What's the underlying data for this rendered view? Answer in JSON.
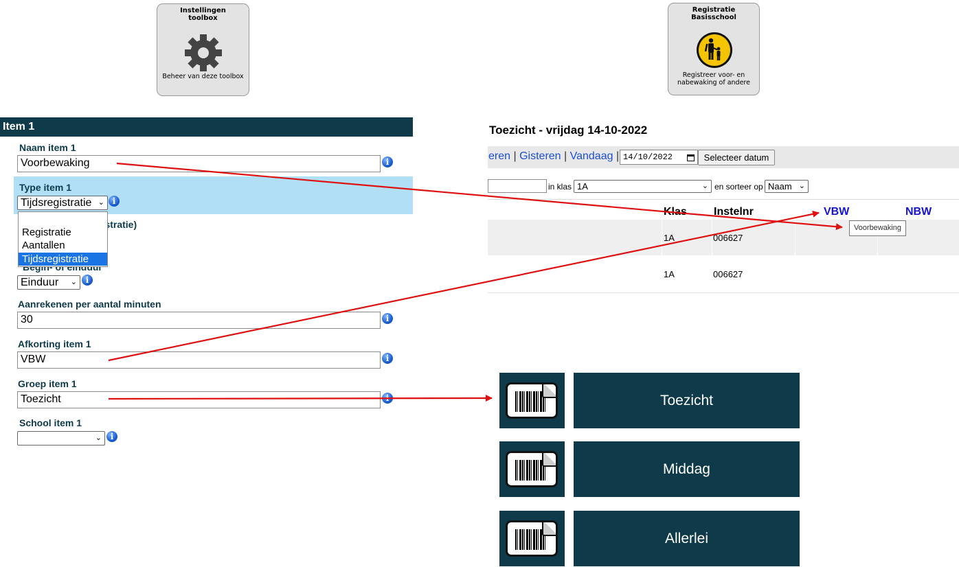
{
  "tiles": {
    "settings": {
      "title_line1": "Instellingen",
      "title_line2": "toolbox",
      "description": "Beheer van deze toolbox",
      "icon": "gear-icon"
    },
    "registration": {
      "title_line1": "Registratie",
      "title_line2": "Basisschool",
      "description_line1": "Registreer voor- en",
      "description_line2": "nabewaking of andere",
      "icon": "parent-child-icon"
    }
  },
  "form": {
    "header": "Item 1",
    "name_label": "Naam item 1",
    "name_value": "Voorbewaking",
    "type_label": "Type item 1",
    "type_value": "Tijdsregistratie",
    "type_options": [
      "Registratie",
      "Aantallen",
      "Tijdsregistratie"
    ],
    "hidden_label_fragment": "gistratie)",
    "begin_label_fragment": "Begin- of einduur",
    "begin_value": "Einduur",
    "minutes_label": "Aanrekenen per aantal minuten",
    "minutes_value": "30",
    "abbr_label": "Afkorting item 1",
    "abbr_value": "VBW",
    "group_label": "Groep item 1",
    "group_value": "Toezicht",
    "school_label": "School item 1",
    "school_value": ""
  },
  "registration_view": {
    "title": "Toezicht - vrijdag 14-10-2022",
    "nav": {
      "prev_fragment": "eren",
      "yesterday": "Gisteren",
      "today": "Vandaag",
      "sep": "|"
    },
    "date_value": "14/10/2022",
    "select_date_button": "Selecteer datum",
    "class_label": "in klas",
    "class_value": "1A",
    "sort_label": "en sorteer op",
    "sort_value": "Naam",
    "columns": {
      "klas": "Klas",
      "instelnr": "Instelnr",
      "vbw": "VBW",
      "nbw": "NBW"
    },
    "rows": [
      {
        "klas": "1A",
        "instelnr": "006627"
      },
      {
        "klas": "1A",
        "instelnr": "006627"
      }
    ],
    "tooltip": "Voorbewaking"
  },
  "groups": [
    {
      "label": "Toezicht"
    },
    {
      "label": "Middag"
    },
    {
      "label": "Allerlei"
    }
  ],
  "colors": {
    "dark_teal": "#0e3a4a",
    "highlight": "#b0dff6",
    "link_blue": "#1a4fd6",
    "arrow_red": "#e01010"
  }
}
